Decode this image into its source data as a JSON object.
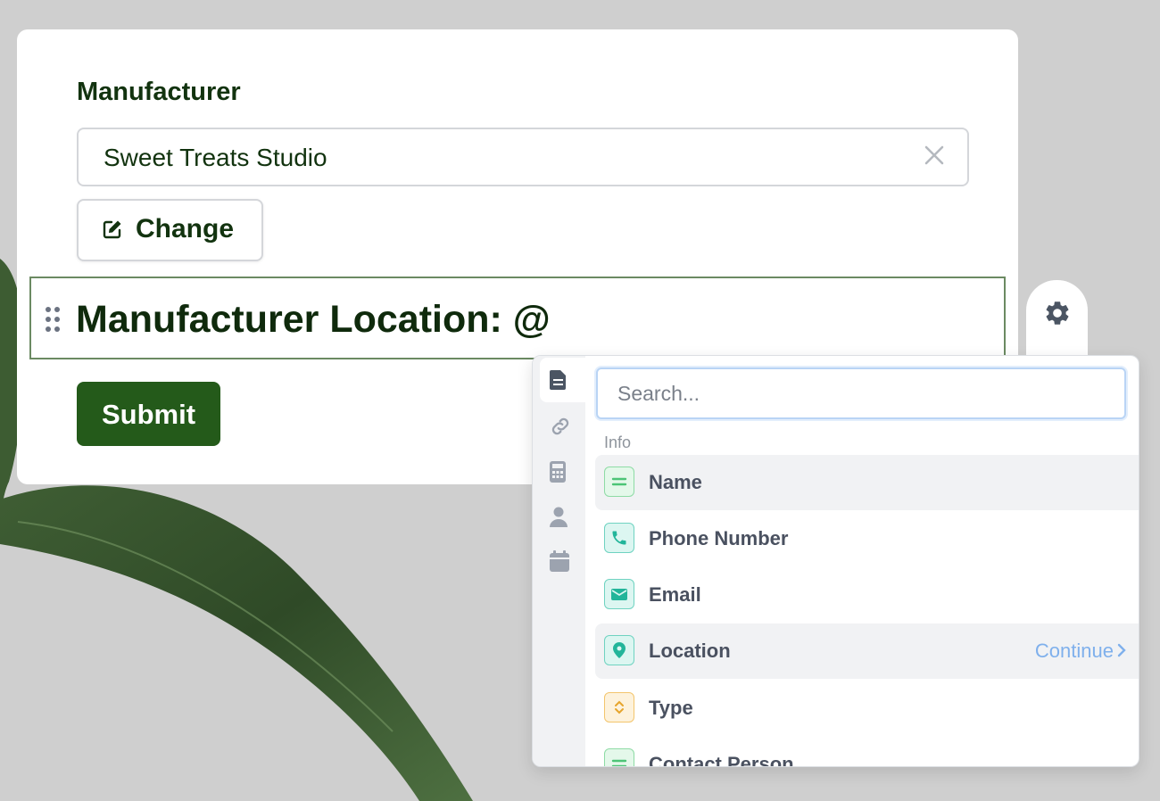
{
  "form": {
    "manufacturer_label": "Manufacturer",
    "manufacturer_value": "Sweet Treats Studio",
    "change_label": "Change",
    "block_text": "Manufacturer Location: @",
    "submit_label": "Submit"
  },
  "popup": {
    "search_placeholder": "Search...",
    "section_label": "Info",
    "items": [
      {
        "label": "Name",
        "icon": "text-lines-icon",
        "color": "#8edba5",
        "highlighted": true
      },
      {
        "label": "Phone Number",
        "icon": "phone-icon",
        "color": "#6fd3c1"
      },
      {
        "label": "Email",
        "icon": "envelope-icon",
        "color": "#6fd3c1"
      },
      {
        "label": "Location",
        "icon": "map-pin-icon",
        "color": "#6fd3c1",
        "highlighted": true,
        "action": "Continue"
      },
      {
        "label": "Type",
        "icon": "chevron-updown-icon",
        "color": "#f3c56d"
      },
      {
        "label": "Contact Person",
        "icon": "text-lines-icon",
        "color": "#8edba5"
      }
    ],
    "rail_icons": [
      "document-icon",
      "link-icon",
      "calculator-icon",
      "person-icon",
      "calendar-icon"
    ]
  },
  "colors": {
    "primary": "#245a1a",
    "text_dark": "#12330f",
    "link": "#7fb0ec",
    "block_border": "#6b8a62"
  }
}
